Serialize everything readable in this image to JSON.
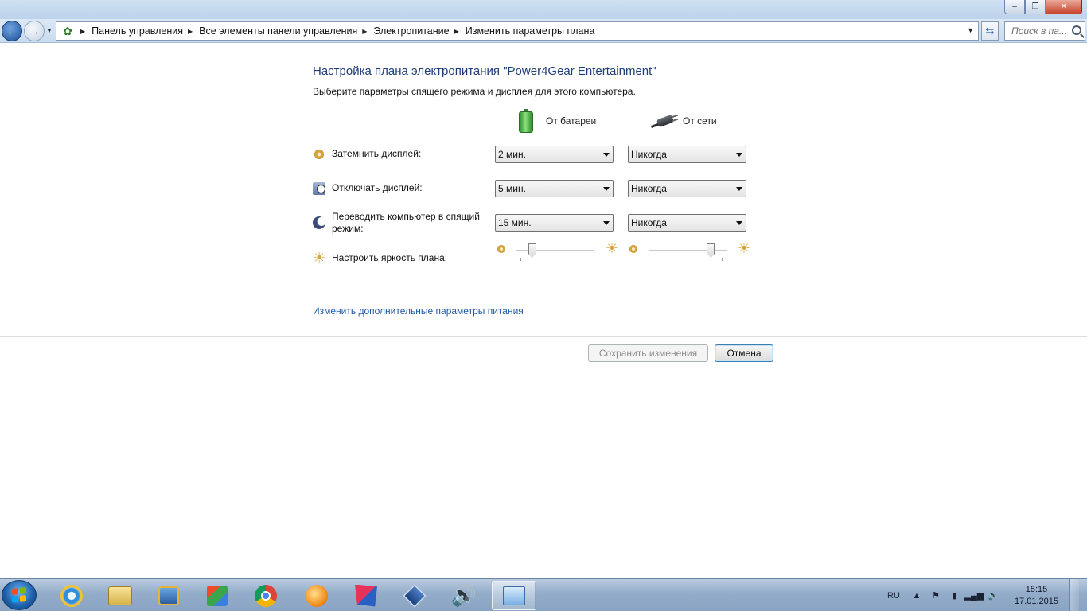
{
  "window": {
    "controls": {
      "minimize": "–",
      "maximize": "❐",
      "close": "✕"
    }
  },
  "navigation": {
    "breadcrumb": [
      "Панель управления",
      "Все элементы панели управления",
      "Электропитание",
      "Изменить параметры плана"
    ],
    "search_placeholder": "Поиск в па..."
  },
  "main": {
    "title": "Настройка плана электропитания \"Power4Gear Entertainment\"",
    "subtitle": "Выберите параметры спящего режима и дисплея для этого компьютера.",
    "columns": {
      "battery": "От батареи",
      "ac": "От сети"
    },
    "rows": [
      {
        "label": "Затемнить дисплей:",
        "battery_value": "2 мин.",
        "ac_value": "Никогда"
      },
      {
        "label": "Отключать дисплей:",
        "battery_value": "5 мин.",
        "ac_value": "Никогда"
      },
      {
        "label": "Переводить компьютер в спящий режим:",
        "battery_value": "15 мин.",
        "ac_value": "Никогда"
      }
    ],
    "brightness": {
      "label": "Настроить яркость плана:",
      "battery_level": 0.2,
      "ac_level": 0.8
    },
    "advanced_link": "Изменить дополнительные параметры питания",
    "save_button": "Сохранить изменения",
    "cancel_button": "Отмена"
  },
  "taskbar": {
    "apps": [
      "internet-explorer",
      "file-explorer",
      "media-player",
      "paint",
      "chrome",
      "aimp",
      "daemon-tools",
      "virtualbox",
      "volume",
      "control-panel"
    ],
    "active_app": "control-panel",
    "language": "RU",
    "time": "15:15",
    "date": "17.01.2015"
  }
}
